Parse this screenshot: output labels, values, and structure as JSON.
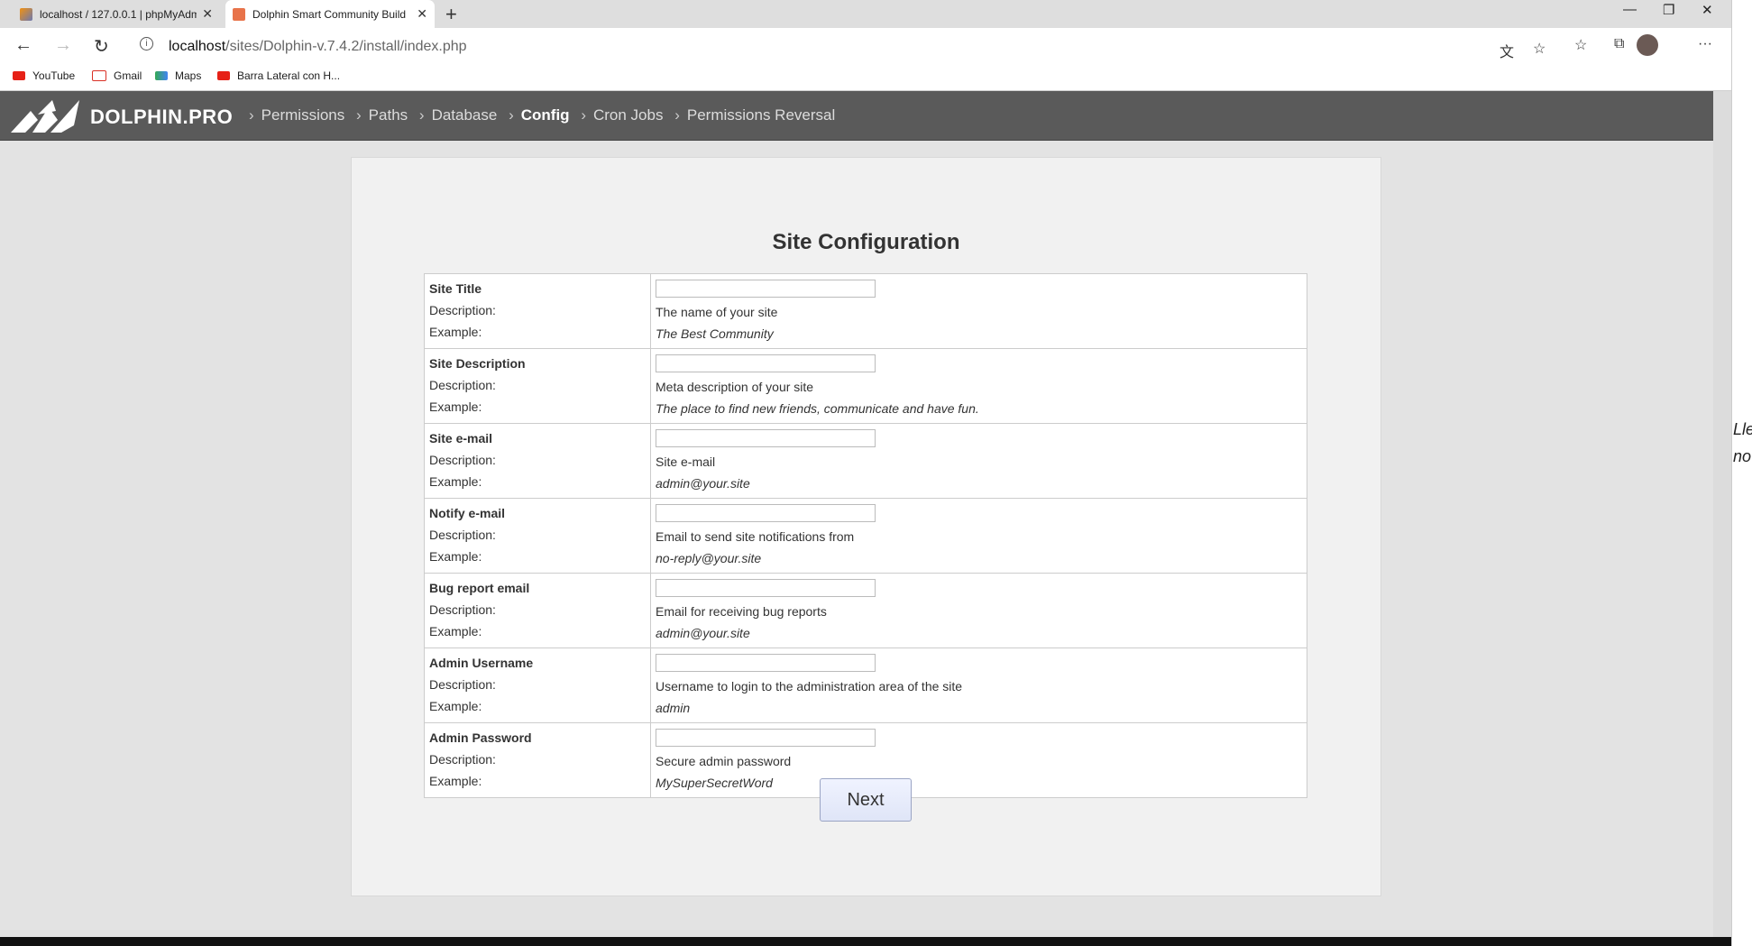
{
  "browser": {
    "tabs": [
      {
        "title": "localhost / 127.0.0.1 | phpMyAdm",
        "active": false
      },
      {
        "title": "Dolphin Smart Community Build",
        "active": true
      }
    ],
    "new_tab": "+",
    "url_host": "localhost",
    "url_path": "/sites/Dolphin-v.7.4.2/install/index.php",
    "bookmarks": [
      {
        "label": "YouTube",
        "icon": "youtube-icon"
      },
      {
        "label": "Gmail",
        "icon": "gmail-icon"
      },
      {
        "label": "Maps",
        "icon": "maps-icon"
      },
      {
        "label": "Barra Lateral con H...",
        "icon": "youtube-icon"
      }
    ]
  },
  "installer": {
    "brand": "DOLPHIN.PRO",
    "steps": [
      {
        "label": "Permissions",
        "active": false
      },
      {
        "label": "Paths",
        "active": false
      },
      {
        "label": "Database",
        "active": false
      },
      {
        "label": "Config",
        "active": true
      },
      {
        "label": "Cron Jobs",
        "active": false
      },
      {
        "label": "Permissions Reversal",
        "active": false
      }
    ],
    "heading": "Site Configuration",
    "description_label": "Description:",
    "example_label": "Example:",
    "fields": [
      {
        "name": "Site Title",
        "value": "",
        "description": "The name of your site",
        "example": "The Best Community"
      },
      {
        "name": "Site Description",
        "value": "",
        "description": "Meta description of your site",
        "example": "The place to find new friends, communicate and have fun."
      },
      {
        "name": "Site e-mail",
        "value": "",
        "description": "Site e-mail",
        "example": "admin@your.site"
      },
      {
        "name": "Notify e-mail",
        "value": "",
        "description": "Email to send site notifications from",
        "example": "no-reply@your.site"
      },
      {
        "name": "Bug report email",
        "value": "",
        "description": "Email for receiving bug reports",
        "example": "admin@your.site"
      },
      {
        "name": "Admin Username",
        "value": "",
        "description": "Username to login to the administration area of the site",
        "example": "admin"
      },
      {
        "name": "Admin Password",
        "value": "",
        "description": "Secure admin password",
        "example": "MySuperSecretWord"
      }
    ],
    "next_label": "Next"
  },
  "side_panel_text": [
    "Lle",
    "no"
  ]
}
